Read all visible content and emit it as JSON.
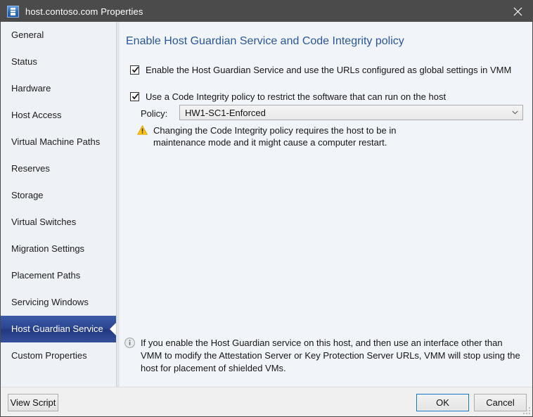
{
  "window": {
    "title": "host.contoso.com Properties",
    "app_icon": "server-properties-icon",
    "close_label": "close-icon",
    "titlebar_color": "#4b4b4b",
    "accent_color": "#2a5699"
  },
  "sidebar": {
    "items": [
      {
        "label": "General",
        "selected": false
      },
      {
        "label": "Status",
        "selected": false
      },
      {
        "label": "Hardware",
        "selected": false
      },
      {
        "label": "Host Access",
        "selected": false
      },
      {
        "label": "Virtual Machine Paths",
        "selected": false
      },
      {
        "label": "Reserves",
        "selected": false
      },
      {
        "label": "Storage",
        "selected": false
      },
      {
        "label": "Virtual Switches",
        "selected": false
      },
      {
        "label": "Migration Settings",
        "selected": false
      },
      {
        "label": "Placement Paths",
        "selected": false
      },
      {
        "label": "Servicing Windows",
        "selected": false
      },
      {
        "label": "Host Guardian Service",
        "selected": true
      },
      {
        "label": "Custom Properties",
        "selected": false
      }
    ]
  },
  "panel": {
    "heading": "Enable Host Guardian Service and Code Integrity policy",
    "hgs_checkbox": {
      "label": "Enable the Host Guardian Service and use the URLs configured as global settings in VMM",
      "checked": true
    },
    "ci_checkbox": {
      "label": "Use a Code Integrity policy to restrict the software that can run on the host",
      "checked": true
    },
    "policy": {
      "label": "Policy:",
      "value": "HW1-SC1-Enforced",
      "options": [
        "HW1-SC1-Enforced"
      ]
    },
    "warning": {
      "icon": "warning-triangle-icon",
      "color": "#ffc20e",
      "text": "Changing the Code Integrity policy requires the host to be in maintenance mode and it might cause a computer restart."
    },
    "info": {
      "icon": "info-circle-icon",
      "color": "#9aa0a6",
      "text": "If you enable the Host Guardian service on this host, and then use an interface other than VMM to modify the Attestation Server or Key Protection Server URLs, VMM will stop using the host for placement of shielded VMs."
    }
  },
  "footer": {
    "view_script_label": "View Script",
    "ok_label": "OK",
    "cancel_label": "Cancel"
  }
}
